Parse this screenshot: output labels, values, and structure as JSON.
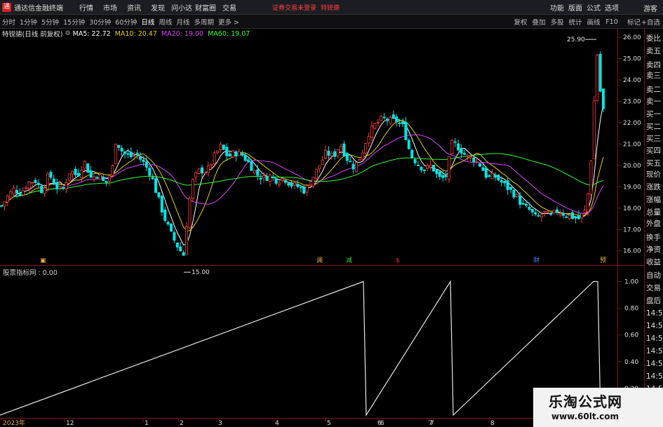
{
  "app": {
    "title": "通达信金融终端"
  },
  "menu": [
    "行情",
    "市场",
    "资讯",
    "发现",
    "问小达",
    "财富圈",
    "交易"
  ],
  "login_hint": "证券交易未登录",
  "stock_hint": "特锐德",
  "right_menu": [
    "功能",
    "版面",
    "公式",
    "选项"
  ],
  "guest": "游客",
  "periods": [
    "分时",
    "1分钟",
    "5分钟",
    "15分钟",
    "30分钟",
    "60分钟",
    "日线",
    "周线",
    "月线",
    "多周期",
    "更多 >"
  ],
  "tools": [
    "复权",
    "叠加",
    "多股",
    "统计",
    "画线",
    "F10"
  ],
  "mark_btn": "标记",
  "fav_btn": "+自选",
  "stock": {
    "name": "特锐德(日线 前复权)"
  },
  "ma": [
    {
      "label": "MA5: 22.72",
      "color": "#ffffff"
    },
    {
      "label": "MA10: 20.47",
      "color": "#e8d000"
    },
    {
      "label": "MA20: 19.00",
      "color": "#e040ff"
    },
    {
      "label": "MA60: 19.07",
      "color": "#30ff30"
    }
  ],
  "indicator": {
    "title": "股票指标网 : 0.00"
  },
  "colors": {
    "up": "#ff3b3b",
    "down": "#00e5e5",
    "grid": "#7a1010",
    "axis": "#e0e0e0"
  },
  "right_panel": [
    "委比",
    "卖五",
    "卖四",
    "卖三",
    "卖二",
    "卖一",
    "买一",
    "买二",
    "买三",
    "买四",
    "买五",
    "现价",
    "涨跌",
    "涨幅",
    "总量",
    "外盘",
    "换手",
    "净资",
    "收益",
    "自动",
    "交易",
    "盘后",
    "14:50",
    "14:50",
    "14:50",
    "14:50",
    "14:50",
    "14:50",
    "14:50",
    "14:50"
  ],
  "watermark": {
    "line1": "乐淘公式网",
    "line2": "www.60lt.com"
  },
  "chart_data": [
    {
      "type": "candlestick",
      "title": "特锐德(日线 前复权)",
      "x_labels": [
        "2023年",
        "12",
        "1",
        "2",
        "3",
        "4",
        "5",
        "6",
        "7",
        "8"
      ],
      "y_ticks": [
        16.0,
        17.0,
        18.0,
        19.0,
        20.0,
        21.0,
        22.0,
        23.0,
        24.0,
        25.0,
        26.0
      ],
      "ylim": [
        15.4,
        26.3
      ],
      "annotations": [
        {
          "text": "25.90",
          "value": 25.9
        },
        {
          "text": "15.00",
          "value": 15.0
        }
      ],
      "event_marks": [
        {
          "text": "▣",
          "color": "#e8b040"
        },
        {
          "text": "澜",
          "color": "#e8b040"
        },
        {
          "text": "减",
          "color": "#40d040"
        },
        {
          "text": "$",
          "color": "#ff3030"
        },
        {
          "text": "财",
          "color": "#4080ff"
        },
        {
          "text": "预",
          "color": "#e8b040"
        }
      ],
      "close_path": [
        [
          0,
          18.0
        ],
        [
          10,
          18.5
        ],
        [
          20,
          18.9
        ],
        [
          30,
          18.7
        ],
        [
          40,
          19.2
        ],
        [
          50,
          19.3
        ],
        [
          60,
          18.8
        ],
        [
          70,
          19.6
        ],
        [
          80,
          19.0
        ],
        [
          90,
          18.9
        ],
        [
          100,
          19.8
        ],
        [
          110,
          19.5
        ],
        [
          120,
          20.2
        ],
        [
          130,
          19.4
        ],
        [
          140,
          19.6
        ],
        [
          150,
          19.1
        ],
        [
          160,
          19.8
        ],
        [
          165,
          21.2
        ],
        [
          175,
          20.6
        ],
        [
          185,
          20.4
        ],
        [
          195,
          20.5
        ],
        [
          205,
          20.1
        ],
        [
          215,
          19.6
        ],
        [
          225,
          18.5
        ],
        [
          235,
          17.5
        ],
        [
          245,
          16.7
        ],
        [
          255,
          16.1
        ],
        [
          262,
          15.8
        ],
        [
          268,
          18.0
        ],
        [
          275,
          19.3
        ],
        [
          285,
          19.8
        ],
        [
          295,
          19.7
        ],
        [
          305,
          20.4
        ],
        [
          315,
          20.9
        ],
        [
          325,
          20.4
        ],
        [
          335,
          20.6
        ],
        [
          345,
          20.5
        ],
        [
          355,
          20.1
        ],
        [
          365,
          19.6
        ],
        [
          375,
          19.4
        ],
        [
          385,
          19.5
        ],
        [
          395,
          19.3
        ],
        [
          405,
          19.4
        ],
        [
          415,
          19.1
        ],
        [
          425,
          19.0
        ],
        [
          435,
          18.8
        ],
        [
          445,
          19.4
        ],
        [
          455,
          20.0
        ],
        [
          465,
          20.6
        ],
        [
          475,
          20.4
        ],
        [
          485,
          21.0
        ],
        [
          495,
          20.3
        ],
        [
          505,
          19.9
        ],
        [
          515,
          20.5
        ],
        [
          525,
          21.5
        ],
        [
          535,
          21.9
        ],
        [
          545,
          22.2
        ],
        [
          555,
          22.1
        ],
        [
          565,
          22.1
        ],
        [
          575,
          21.8
        ],
        [
          585,
          20.5
        ],
        [
          595,
          20.1
        ],
        [
          605,
          19.8
        ],
        [
          615,
          20.0
        ],
        [
          625,
          19.4
        ],
        [
          635,
          19.4
        ],
        [
          645,
          21.1
        ],
        [
          655,
          20.8
        ],
        [
          665,
          20.4
        ],
        [
          675,
          20.3
        ],
        [
          685,
          20.0
        ],
        [
          695,
          19.4
        ],
        [
          705,
          19.5
        ],
        [
          715,
          19.2
        ],
        [
          725,
          18.9
        ],
        [
          735,
          18.6
        ],
        [
          745,
          18.1
        ],
        [
          755,
          17.9
        ],
        [
          765,
          17.5
        ],
        [
          775,
          17.8
        ],
        [
          785,
          17.6
        ],
        [
          795,
          17.9
        ],
        [
          805,
          17.7
        ],
        [
          815,
          17.6
        ],
        [
          825,
          17.5
        ],
        [
          835,
          17.9
        ],
        [
          840,
          19.2
        ],
        [
          845,
          21.5
        ],
        [
          850,
          25.7
        ],
        [
          855,
          23.6
        ],
        [
          860,
          22.6
        ]
      ]
    },
    {
      "type": "line",
      "series": [
        {
          "name": "股票指标网",
          "values": [
            0,
            1,
            0,
            1,
            0,
            1,
            1,
            0
          ]
        }
      ],
      "spike_labels": [
        "6",
        "7",
        "预"
      ],
      "y_ticks": [
        0.2,
        0.4,
        0.6,
        0.8,
        1.0
      ],
      "ylim": [
        0,
        1.05
      ]
    }
  ]
}
